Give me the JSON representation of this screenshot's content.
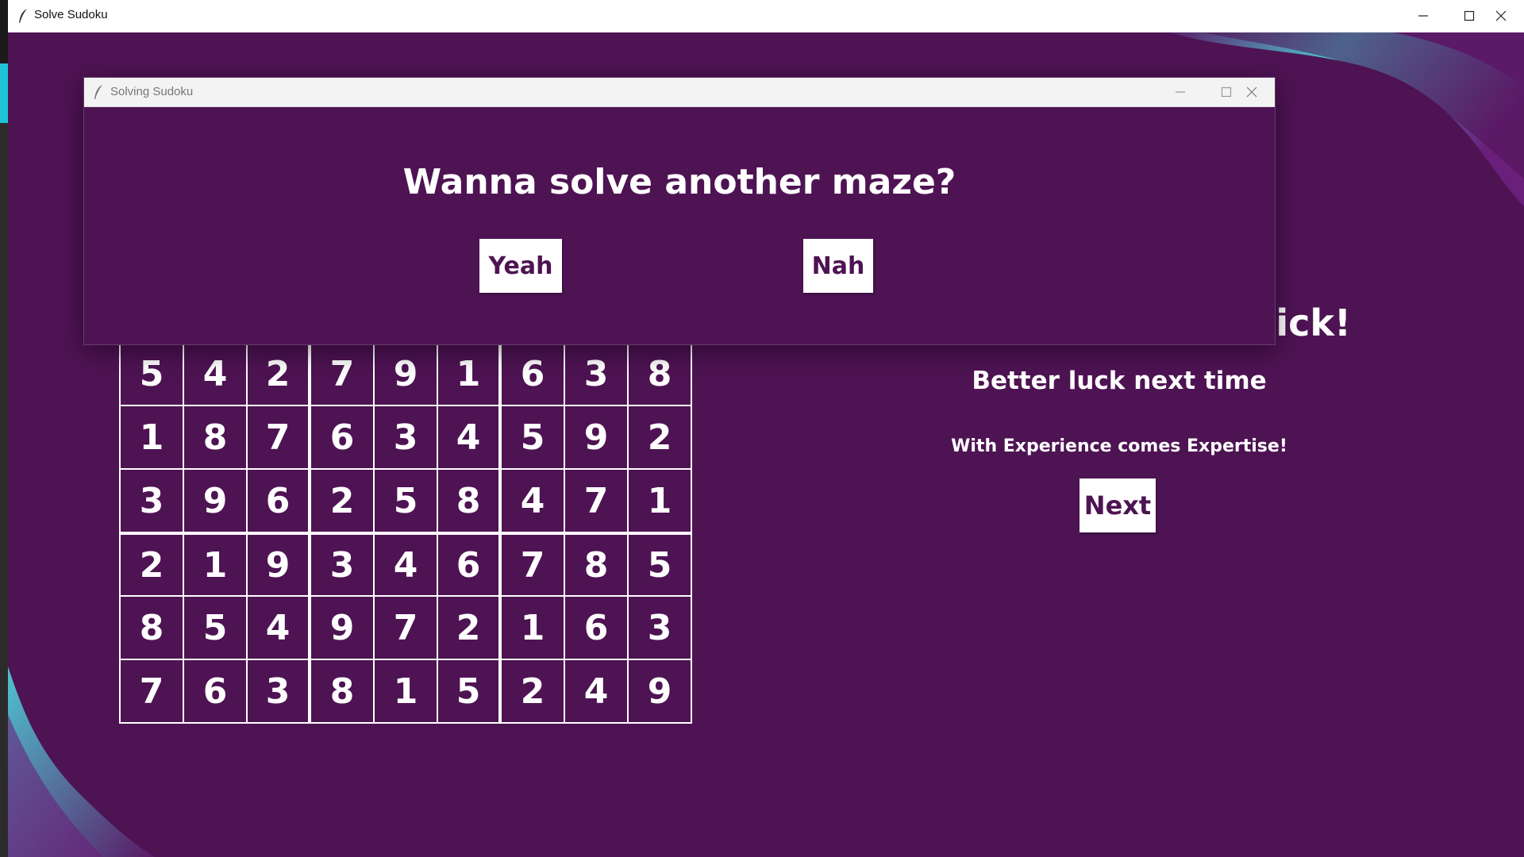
{
  "main_window": {
    "title": "Solve Sudoku",
    "icon": "feather-icon",
    "background_color": "#4e1353",
    "controls": [
      "minimize-icon",
      "maximize-icon",
      "close-icon"
    ]
  },
  "dialog": {
    "title": "Solving Sudoku",
    "icon": "feather-icon",
    "question": "Wanna solve another maze?",
    "yes_label": "Yeah",
    "no_label": "Nah",
    "controls": [
      "minimize-icon",
      "maximize-icon",
      "close-icon"
    ]
  },
  "board": {
    "visible_rows": [
      [
        5,
        4,
        2,
        7,
        9,
        1,
        6,
        3,
        8
      ],
      [
        1,
        8,
        7,
        6,
        3,
        4,
        5,
        9,
        2
      ],
      [
        3,
        9,
        6,
        2,
        5,
        8,
        4,
        7,
        1
      ],
      [
        2,
        1,
        9,
        3,
        4,
        6,
        7,
        8,
        5
      ],
      [
        8,
        5,
        4,
        9,
        7,
        2,
        1,
        6,
        3
      ],
      [
        7,
        6,
        3,
        8,
        1,
        5,
        2,
        4,
        9
      ]
    ]
  },
  "result": {
    "heading_partial": "uick!",
    "message": "Better luck next time",
    "tagline": "With Experience comes Expertise!",
    "next_label": "Next"
  },
  "colors": {
    "accent": "#4e1353",
    "wave_teal": "#4fc3d1",
    "text": "#ffffff"
  }
}
